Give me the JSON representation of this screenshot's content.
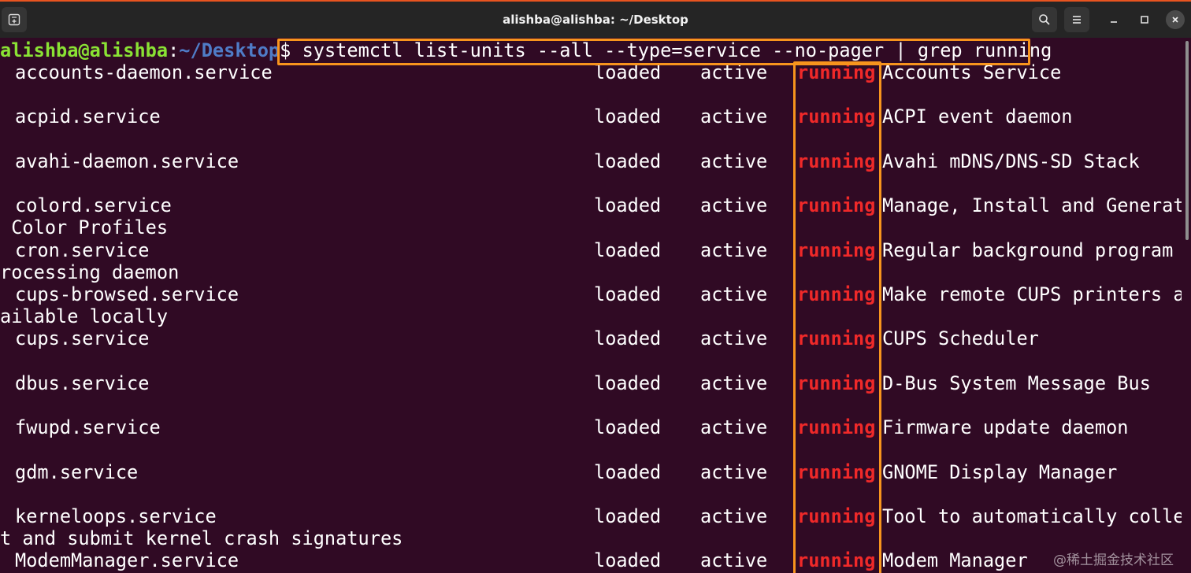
{
  "colors": {
    "accent_line": "#e95420",
    "terminal_bg": "#300a24",
    "highlight_box": "#f7941d",
    "running_text": "#ef2929",
    "prompt_user": "#8ae234",
    "prompt_path": "#4f7cc7"
  },
  "window": {
    "title": "alishba@alishba: ~/Desktop",
    "new_tab_icon": "new-tab-icon",
    "search_icon": "search-icon",
    "menu_icon": "hamburger-menu-icon",
    "minimize_icon": "minimize-icon",
    "maximize_icon": "maximize-icon",
    "close_icon": "close-icon"
  },
  "prompt": {
    "user": "alishba@alishba",
    "separator": ":",
    "path": "~/Desktop",
    "symbol": "$ ",
    "command": "systemctl list-units --all --type=service --no-pager | grep running"
  },
  "services": [
    {
      "unit": "accounts-daemon.service",
      "load": "loaded",
      "active": "active",
      "sub": "running",
      "description": "Accounts Service",
      "continuation": ""
    },
    {
      "unit": "acpid.service",
      "load": "loaded",
      "active": "active",
      "sub": "running",
      "description": "ACPI event daemon",
      "continuation": ""
    },
    {
      "unit": "avahi-daemon.service",
      "load": "loaded",
      "active": "active",
      "sub": "running",
      "description": "Avahi mDNS/DNS-SD Stack",
      "continuation": ""
    },
    {
      "unit": "colord.service",
      "load": "loaded",
      "active": "active",
      "sub": "running",
      "description": "Manage, Install and Generate",
      "continuation": " Color Profiles"
    },
    {
      "unit": "cron.service",
      "load": "loaded",
      "active": "active",
      "sub": "running",
      "description": "Regular background program p",
      "continuation": "rocessing daemon"
    },
    {
      "unit": "cups-browsed.service",
      "load": "loaded",
      "active": "active",
      "sub": "running",
      "description": "Make remote CUPS printers av",
      "continuation": "ailable locally"
    },
    {
      "unit": "cups.service",
      "load": "loaded",
      "active": "active",
      "sub": "running",
      "description": "CUPS Scheduler",
      "continuation": ""
    },
    {
      "unit": "dbus.service",
      "load": "loaded",
      "active": "active",
      "sub": "running",
      "description": "D-Bus System Message Bus",
      "continuation": ""
    },
    {
      "unit": "fwupd.service",
      "load": "loaded",
      "active": "active",
      "sub": "running",
      "description": "Firmware update daemon",
      "continuation": ""
    },
    {
      "unit": "gdm.service",
      "load": "loaded",
      "active": "active",
      "sub": "running",
      "description": "GNOME Display Manager",
      "continuation": ""
    },
    {
      "unit": "kerneloops.service",
      "load": "loaded",
      "active": "active",
      "sub": "running",
      "description": "Tool to automatically collec",
      "continuation": "t and submit kernel crash signatures"
    },
    {
      "unit": "ModemManager.service",
      "load": "loaded",
      "active": "active",
      "sub": "running",
      "description": "Modem Manager",
      "continuation": ""
    }
  ],
  "watermark": "@稀土掘金技术社区"
}
